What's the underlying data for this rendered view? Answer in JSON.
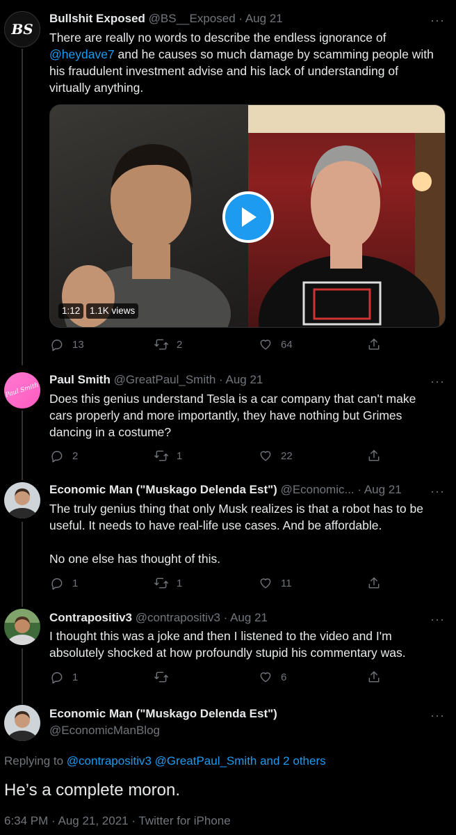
{
  "tweets": [
    {
      "name": "Bullshit Exposed",
      "handle": "@BS__Exposed",
      "date": "Aug 21",
      "avatar_text": "BS",
      "text_before": "There are really no words to describe the endless ignorance of",
      "mention": "@heydave7",
      "text_after": " and he causes so much damage by scamming people with his fraudulent investment advise and his lack of understanding of virtually anything.",
      "video": {
        "duration": "1:12",
        "views": "1.1K views"
      },
      "replies": "13",
      "retweets": "2",
      "likes": "64"
    },
    {
      "name": "Paul Smith",
      "handle": "@GreatPaul_Smith",
      "date": "Aug 21",
      "avatar_text": "Paul Smith",
      "text": "Does this genius understand Tesla is a car company that can't make cars properly and more importantly, they have nothing but Grimes dancing in a costume?",
      "replies": "2",
      "retweets": "1",
      "likes": "22"
    },
    {
      "name": "Economic Man (\"Muskago Delenda Est\")",
      "handle": "@Economic...",
      "date": "Aug 21",
      "text": "The truly genius thing that only Musk realizes is that a robot has to be useful. It needs to have real-life use cases. And be affordable.",
      "text2": "No one else has thought of this.",
      "replies": "1",
      "retweets": "1",
      "likes": "11"
    },
    {
      "name": "Contrapositiv3",
      "handle": "@contrapositiv3",
      "date": "Aug 21",
      "text": "I thought this was a joke and then I listened to the video and I'm absolutely shocked at how profoundly stupid his commentary was.",
      "replies": "1",
      "retweets": "",
      "likes": "6"
    }
  ],
  "main_tweet": {
    "name": "Economic Man (\"Muskago Delenda Est\")",
    "handle": "@EconomicManBlog",
    "replying_label": "Replying to",
    "replying_to": "@contrapositiv3 @GreatPaul_Smith and 2 others",
    "text": "He’s a complete moron.",
    "footer": "6:34 PM · Aug 21, 2021 · Twitter for iPhone"
  },
  "more_symbol": "···",
  "meta_sep": " · ",
  "icons": [
    "reply-icon",
    "retweet-icon",
    "like-icon",
    "share-icon",
    "play-icon",
    "more-icon"
  ],
  "colors": {
    "background": "#000000",
    "accent": "#1d9bf0",
    "muted": "#71767b",
    "text": "#e7e9ea"
  }
}
